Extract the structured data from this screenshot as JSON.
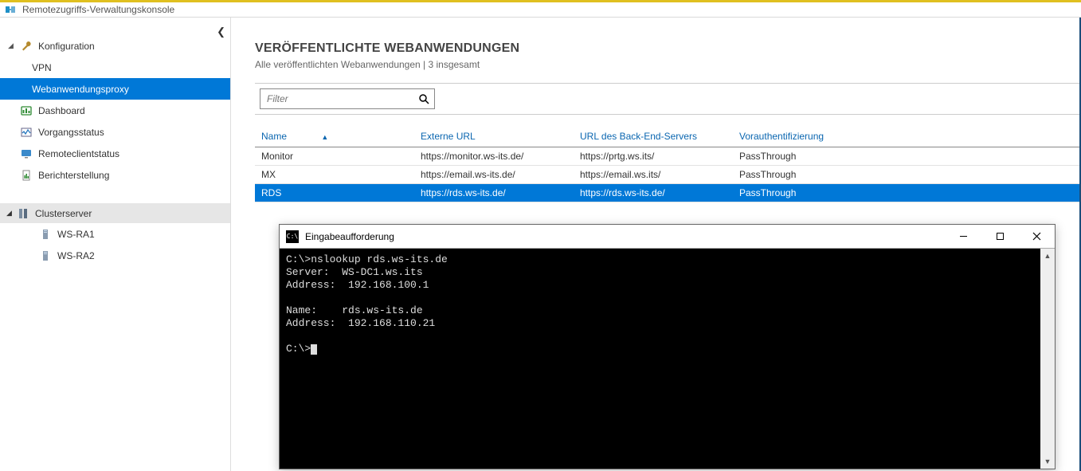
{
  "app": {
    "title": "Remotezugriffs-Verwaltungskonsole"
  },
  "sidebar": {
    "config_label": "Konfiguration",
    "vpn_label": "VPN",
    "wap_label": "Webanwendungsproxy",
    "dashboard_label": "Dashboard",
    "opstatus_label": "Vorgangsstatus",
    "remoteclient_label": "Remoteclientstatus",
    "reporting_label": "Berichterstellung",
    "cluster_label": "Clusterserver",
    "nodes": [
      "WS-RA1",
      "WS-RA2"
    ]
  },
  "main": {
    "title": "VERÖFFENTLICHTE WEBANWENDUNGEN",
    "subtitle": "Alle veröffentlichten Webanwendungen | 3 insgesamt",
    "filter_placeholder": "Filter",
    "columns": {
      "name": "Name",
      "external": "Externe URL",
      "backend": "URL des Back-End-Servers",
      "preauth": "Vorauthentifizierung"
    },
    "rows": [
      {
        "name": "Monitor",
        "external": "https://monitor.ws-its.de/",
        "backend": "https://prtg.ws.its/",
        "preauth": "PassThrough",
        "selected": false
      },
      {
        "name": "MX",
        "external": "https://email.ws-its.de/",
        "backend": "https://email.ws.its/",
        "preauth": "PassThrough",
        "selected": false
      },
      {
        "name": "RDS",
        "external": "https://rds.ws-its.de/",
        "backend": "https://rds.ws-its.de/",
        "preauth": "PassThrough",
        "selected": true
      }
    ]
  },
  "console": {
    "title": "Eingabeaufforderung",
    "lines": [
      "C:\\>nslookup rds.ws-its.de",
      "Server:  WS-DC1.ws.its",
      "Address:  192.168.100.1",
      "",
      "Name:    rds.ws-its.de",
      "Address:  192.168.110.21",
      "",
      "C:\\>"
    ]
  }
}
